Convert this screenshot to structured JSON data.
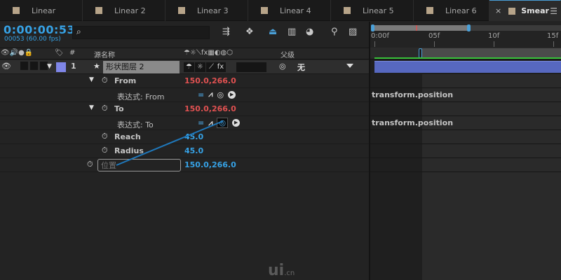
{
  "tabs": [
    {
      "label": "Linear",
      "active": false
    },
    {
      "label": "Linear 2",
      "active": false
    },
    {
      "label": "Linear 3",
      "active": false
    },
    {
      "label": "Linear 4",
      "active": false
    },
    {
      "label": "Linear 5",
      "active": false
    },
    {
      "label": "Linear 6",
      "active": false
    },
    {
      "label": "Smear",
      "active": true
    }
  ],
  "tab_close": "×",
  "tab_menu": "☰",
  "header": {
    "timecode": "0:00:00:53",
    "frames_fps": "00053 (60.00 fps)",
    "search_icon": "⌕",
    "search_placeholder": ""
  },
  "columns": {
    "hash": "#",
    "source_name": "源名称",
    "parent": "父级"
  },
  "layer": {
    "number": "1",
    "star": "★",
    "name": "形状图层 2",
    "parent_value": "无",
    "parent_icon": "spiral-icon"
  },
  "properties": {
    "from_name": "From",
    "from_value": "150.0,266.0",
    "from_expr_label": "表达式: From",
    "to_name": "To",
    "to_value": "150.0,266.0",
    "to_expr_label": "表达式: To",
    "reach_name": "Reach",
    "reach_value": "45.0",
    "radius_name": "Radius",
    "radius_value": "45.0",
    "position_placeholder": "位置",
    "position_value": "150.0,266.0"
  },
  "timeline": {
    "ticks": [
      "0:00f",
      "05f",
      "10f",
      "15f"
    ],
    "from_expression": "transform.position",
    "to_expression": "transform.position"
  },
  "colors": {
    "accent_blue": "#36a2e6",
    "value_red": "#e05151",
    "layer_label": "#7f86e8",
    "layer_bar": "#5768c0",
    "work_area_green": "#39c43a"
  },
  "watermark": {
    "mark": "ui",
    "suffix": ".cn"
  }
}
